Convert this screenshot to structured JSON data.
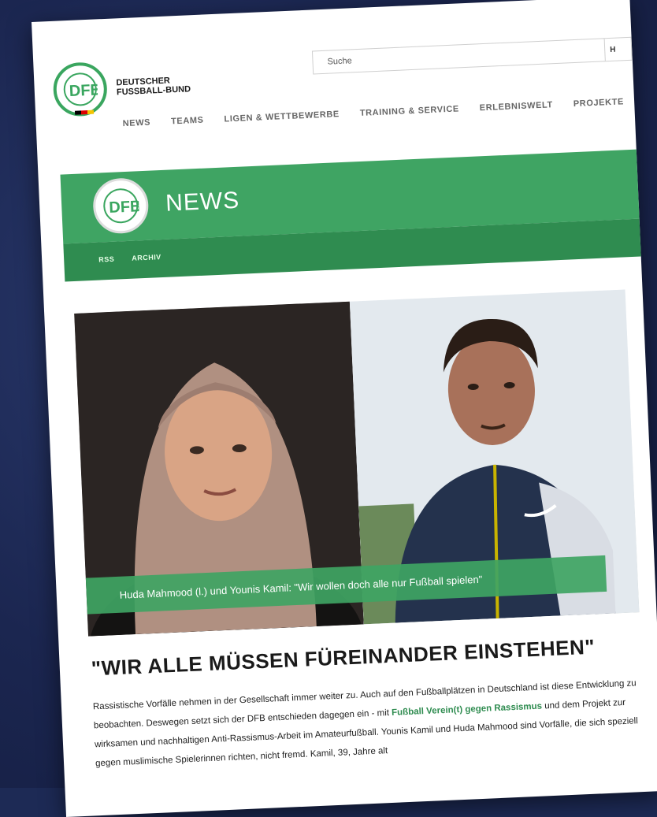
{
  "brand": {
    "line1": "DEUTSCHER",
    "line2": "FUSSBALL-BUND"
  },
  "search": {
    "placeholder": "Suche",
    "button_label": "H"
  },
  "nav": [
    "NEWS",
    "TEAMS",
    "LIGEN & WETTBEWERBE",
    "TRAINING & SERVICE",
    "ERLEBNISWELT",
    "PROJEKTE"
  ],
  "section": {
    "title": "NEWS",
    "links": [
      "RSS",
      "ARCHIV"
    ]
  },
  "hero": {
    "caption": "Huda Mahmood (l.) und Younis Kamil: \"Wir wollen doch alle nur Fußball spielen\""
  },
  "article": {
    "headline": "\"WIR ALLE MÜSSEN FÜREINANDER EINSTEHEN\"",
    "p_before": "Rassistische Vorfälle nehmen in der Gesellschaft immer weiter zu. Auch auf den Fußballplätzen in Deutschland ist diese Entwicklung zu beobachten. Deswegen setzt sich der DFB entschieden dagegen ein - mit ",
    "link": "Fußball Verein(t) gegen Rassismus",
    "p_after": " und dem Projekt zur wirksamen und nachhaltigen Anti-Rassismus-Arbeit im Amateurfußball. Younis Kamil und Huda Mahmood sind Vorfälle, die sich speziell gegen muslimische Spielerinnen richten, nicht fremd. Kamil, 39, Jahre alt"
  },
  "colors": {
    "green": "#3fa463",
    "dark_green": "#2f8c50",
    "background": "#1d2a55"
  }
}
